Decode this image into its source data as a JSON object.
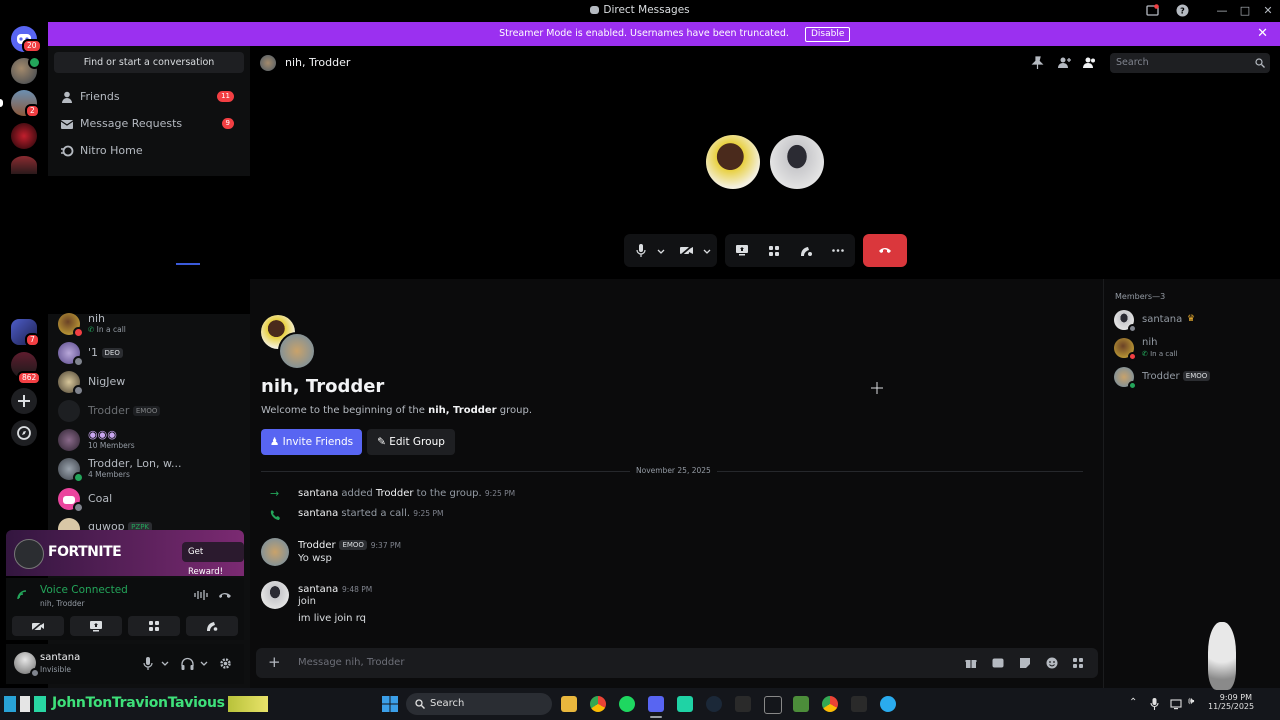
{
  "window": {
    "title": "Direct Messages"
  },
  "banner": {
    "message": "Streamer Mode is enabled. Usernames have been truncated.",
    "disable_label": "Disable"
  },
  "rail": {
    "badges": [
      "20",
      "2",
      "7",
      "862"
    ]
  },
  "sidebar": {
    "search_placeholder": "Find or start a conversation",
    "nav": [
      {
        "label": "Friends",
        "count": "11"
      },
      {
        "label": "Message Requests",
        "count": "9"
      },
      {
        "label": "Nitro Home",
        "count": ""
      }
    ],
    "dms": [
      {
        "name": "nih",
        "sub": "In a call"
      },
      {
        "name": "'1",
        "tag": "DEO"
      },
      {
        "name": "NigJew"
      },
      {
        "name": "Trodder",
        "tag": "EMOO"
      },
      {
        "name": "",
        "sub": "10 Members"
      },
      {
        "name": "Trodder, Lon, w...",
        "sub": "4 Members"
      },
      {
        "name": "Coal"
      },
      {
        "name": "guwop",
        "tag": "PZPK"
      }
    ]
  },
  "promo": {
    "brand": "FORTNITE",
    "button": "Get Reward!"
  },
  "voice": {
    "status": "Voice Connected",
    "channel": "nih, Trodder"
  },
  "user": {
    "name": "santana",
    "status": "Invisible"
  },
  "header": {
    "title": "nih, Trodder",
    "search_placeholder": "Search"
  },
  "chat": {
    "title": "nih, Trodder",
    "welcome_prefix": "Welcome to the beginning of the ",
    "welcome_name": "nih, Trodder",
    "welcome_suffix": " group.",
    "invite_label": "Invite Friends",
    "edit_label": "Edit Group",
    "date_divider": "November 25, 2025",
    "system": [
      {
        "actor": "santana",
        "text": " added ",
        "target": "Trodder",
        "tail": " to the group.",
        "time": "9:25 PM"
      },
      {
        "actor": "santana",
        "text": " started a call.",
        "target": "",
        "tail": "",
        "time": "9:25 PM"
      }
    ],
    "messages": [
      {
        "author": "Trodder",
        "tag": "EMOO",
        "time": "9:37 PM",
        "lines": [
          "Yo wsp"
        ]
      },
      {
        "author": "santana",
        "tag": "",
        "time": "9:48 PM",
        "lines": [
          "join",
          "im live join rq"
        ]
      }
    ],
    "composer_placeholder": "Message nih, Trodder"
  },
  "members": {
    "heading": "Members—3",
    "list": [
      {
        "name": "santana",
        "sub": "",
        "tag": ""
      },
      {
        "name": "nih",
        "sub": "In a call",
        "tag": ""
      },
      {
        "name": "Trodder",
        "sub": "",
        "tag": "EMOO"
      }
    ]
  },
  "taskbar": {
    "widget_text": "JohnTonTravionTavious :",
    "search_label": "Search",
    "time": "9:09 PM",
    "date": "11/25/2025"
  },
  "colors": {
    "accent": "#5865f2",
    "banner": "#9b30f0",
    "danger": "#da373c",
    "online": "#23a55a"
  }
}
